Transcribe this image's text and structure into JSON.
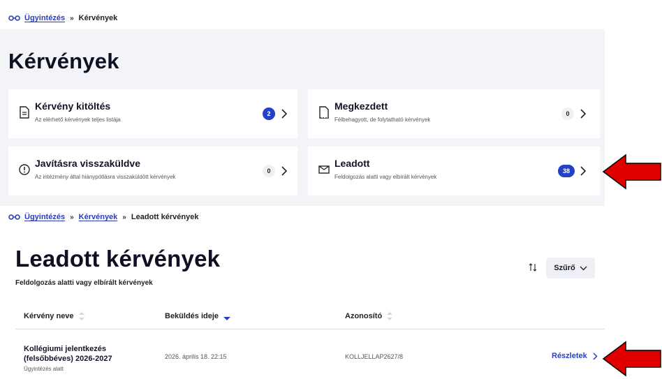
{
  "top": {
    "breadcrumb": {
      "root": "Ügyintézés",
      "current": "Kérvények"
    },
    "title": "Kérvények",
    "cards": [
      {
        "title": "Kérvény kitöltés",
        "subtitle": "Az elérhető kérvények teljes listája",
        "count": "2",
        "icon": "document-icon"
      },
      {
        "title": "Megkezdett",
        "subtitle": "Félbehagyott, de folytatható kérvények",
        "count": "0",
        "icon": "draft-document-icon"
      },
      {
        "title": "Javításra visszaküldve",
        "subtitle": "Az intézmény által hiánypótlásra visszaküldött kérvények",
        "count": "0",
        "icon": "alert-circle-icon"
      },
      {
        "title": "Leadott",
        "subtitle": "Feldolgozás alatti vagy elbírált kérvények",
        "count": "38",
        "icon": "envelope-icon"
      }
    ]
  },
  "bottom": {
    "breadcrumb": {
      "root": "Ügyintézés",
      "middle": "Kérvények",
      "current": "Leadott kérvények"
    },
    "title": "Leadott kérvények",
    "subtitle": "Feldolgozás alatti vagy elbírált kérvények",
    "filter_label": "Szűrő",
    "columns": {
      "name": "Kérvény neve",
      "submitted": "Beküldés ideje",
      "id": "Azonosító"
    },
    "rows": [
      {
        "name": "Kollégiumi jelentkezés (felsőbbéves) 2026-2027",
        "status": "Ügyintézés alatt",
        "submitted": "2026. április 18. 22:15",
        "id": "KOLLJELLAP2627/8",
        "action": "Részletek"
      }
    ]
  },
  "colors": {
    "accent": "#243fc8",
    "panel": "#f3f4f8",
    "annotation_arrow": "#e00000"
  }
}
